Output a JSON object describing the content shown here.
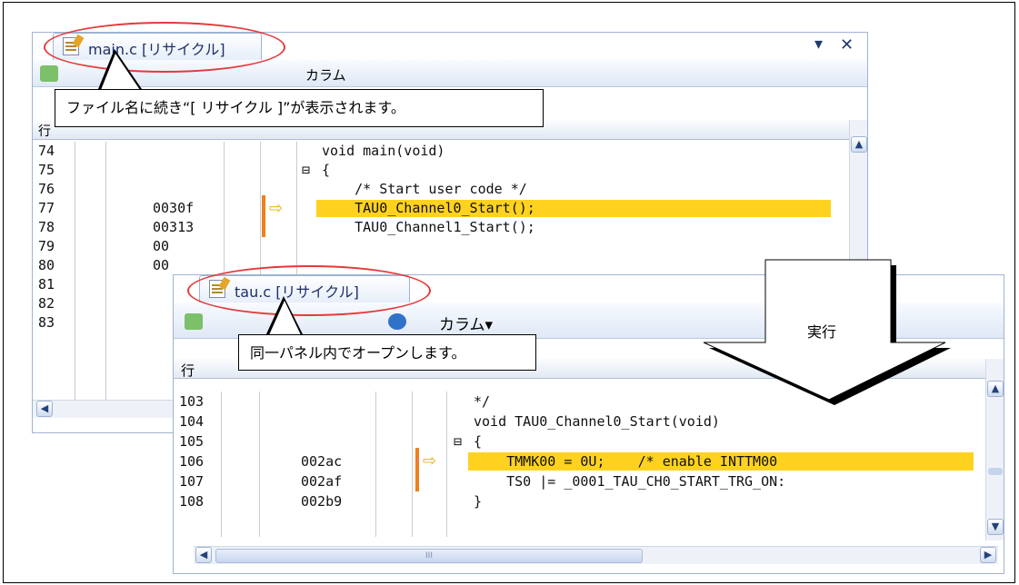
{
  "main_panel": {
    "tab_label": "main.c [リサイクル]",
    "dropdown_glyph": "▾",
    "close_glyph": "✕",
    "toolbar_label": "カラム",
    "header_col": "行",
    "lines": [
      {
        "line": "74",
        "addr": "",
        "code": "void main(void)",
        "exec": false,
        "marker": ""
      },
      {
        "line": "75",
        "addr": "",
        "code": "{",
        "exec": false,
        "marker": "⊟"
      },
      {
        "line": "76",
        "addr": "",
        "code": "    /* Start user code */",
        "exec": false,
        "marker": ""
      },
      {
        "line": "77",
        "addr": "0030f",
        "code": "    TAU0_Channel0_Start();",
        "exec": true,
        "marker": ""
      },
      {
        "line": "78",
        "addr": "00313",
        "code": "    TAU0_Channel1_Start();",
        "exec": false,
        "marker": ""
      },
      {
        "line": "79",
        "addr": "00",
        "code": "",
        "exec": false,
        "marker": ""
      },
      {
        "line": "80",
        "addr": "00",
        "code": "",
        "exec": false,
        "marker": ""
      },
      {
        "line": "81",
        "addr": "",
        "code": "",
        "exec": false,
        "marker": ""
      },
      {
        "line": "82",
        "addr": "",
        "code": "",
        "exec": false,
        "marker": ""
      },
      {
        "line": "83",
        "addr": "",
        "code": "",
        "exec": false,
        "marker": ""
      }
    ]
  },
  "tau_panel": {
    "tab_label": "tau.c [リサイクル]",
    "toolbar_label": "カラム▾",
    "header_col": "行",
    "lines": [
      {
        "line": "103",
        "addr": "",
        "code": "*/",
        "exec": false,
        "marker": ""
      },
      {
        "line": "104",
        "addr": "",
        "code": "void TAU0_Channel0_Start(void)",
        "exec": false,
        "marker": ""
      },
      {
        "line": "105",
        "addr": "",
        "code": "{",
        "exec": false,
        "marker": "⊟"
      },
      {
        "line": "106",
        "addr": "002ac",
        "code": "    TMMK00 = 0U;    /* enable INTTM00",
        "exec": true,
        "marker": ""
      },
      {
        "line": "107",
        "addr": "002af",
        "code": "    TS0 |= _0001_TAU_CH0_START_TRG_ON:",
        "exec": false,
        "marker": ""
      },
      {
        "line": "108",
        "addr": "002b9",
        "code": "}",
        "exec": false,
        "marker": ""
      }
    ],
    "hscroll_mark": "III"
  },
  "callouts": {
    "main_note": "ファイル名に続き“[ リサイクル ]”が表示されます。",
    "tau_note": "同一パネル内でオープンします。",
    "arrow_label": "実行"
  },
  "glyphs": {
    "scroll_up": "▲",
    "scroll_down": "▼",
    "scroll_left": "◀",
    "scroll_right": "▶",
    "exec_arrow": "⇨"
  },
  "colors": {
    "highlight": "#ffd21f",
    "pc_bar": "#f0801a",
    "callout_ellipse": "#e43a3a",
    "tab_text": "#1f2f6a"
  }
}
